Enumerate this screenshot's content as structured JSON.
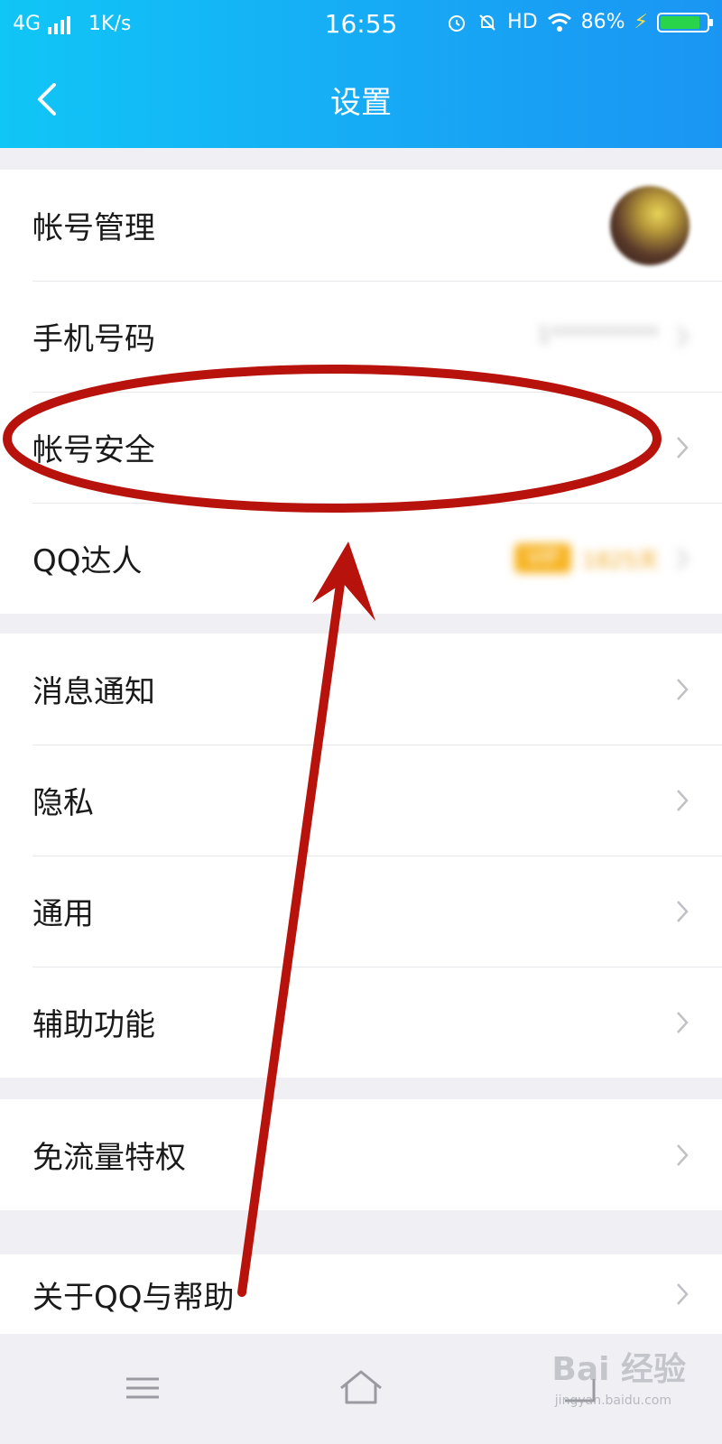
{
  "status_bar": {
    "network": "4G",
    "speed": "1K/s",
    "time": "16:55",
    "hd": "HD",
    "battery": "86%",
    "battery_level": 0.86
  },
  "header": {
    "title": "设置"
  },
  "sections": [
    {
      "rows": [
        {
          "label": "帐号管理"
        },
        {
          "label": "手机号码",
          "value": "1**********"
        },
        {
          "label": "帐号安全"
        },
        {
          "label": "QQ达人",
          "badge": "VIP",
          "value": "1825天"
        }
      ]
    },
    {
      "rows": [
        {
          "label": "消息通知"
        },
        {
          "label": "隐私"
        },
        {
          "label": "通用"
        },
        {
          "label": "辅助功能"
        }
      ]
    },
    {
      "rows": [
        {
          "label": "免流量特权"
        }
      ]
    },
    {
      "rows": [
        {
          "label": "关于QQ与帮助"
        }
      ]
    }
  ],
  "watermark": {
    "text": "Bai 经验",
    "sub": "jingyan.baidu.com"
  },
  "colors": {
    "header_start": "#10c6f6",
    "header_end": "#1a95f3",
    "annotation_red": "#b8120c"
  }
}
